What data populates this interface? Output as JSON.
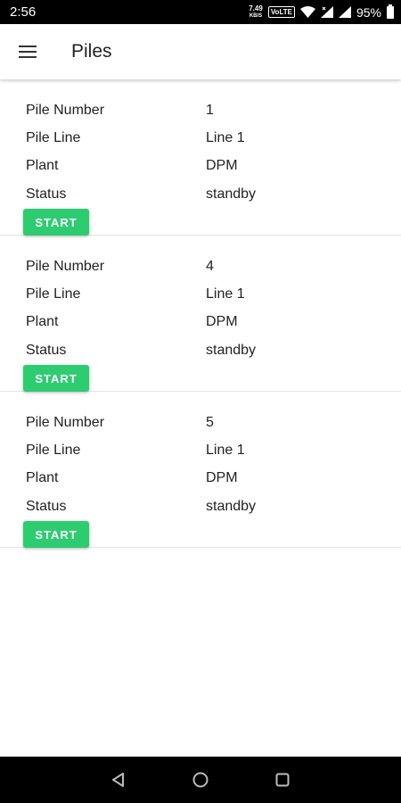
{
  "status_bar": {
    "time": "2:56",
    "net_speed_top": "7.49",
    "net_speed_bottom": "KB/S",
    "volte": "VoLTE",
    "battery": "95%"
  },
  "app_bar": {
    "title": "Piles"
  },
  "labels": {
    "pile_number": "Pile Number",
    "pile_line": "Pile Line",
    "plant": "Plant",
    "status": "Status",
    "start_button": "START"
  },
  "piles": [
    {
      "pile_number": "1",
      "pile_line": "Line 1",
      "plant": "DPM",
      "status": "standby"
    },
    {
      "pile_number": "4",
      "pile_line": "Line 1",
      "plant": "DPM",
      "status": "standby"
    },
    {
      "pile_number": "5",
      "pile_line": "Line 1",
      "plant": "DPM",
      "status": "standby"
    }
  ],
  "colors": {
    "accent": "#2ecc71",
    "status_bar": "#000000",
    "nav_bar": "#000000"
  }
}
